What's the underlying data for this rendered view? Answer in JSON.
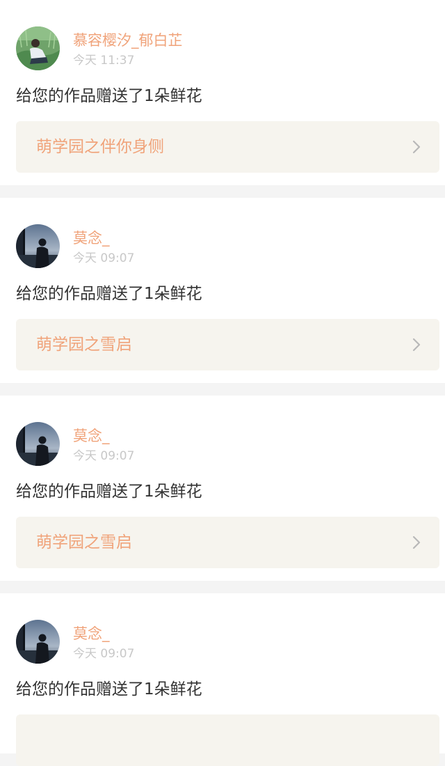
{
  "notifications": [
    {
      "username": "慕容樱汐_郁白芷",
      "time": "今天 11:37",
      "message": "给您的作品赠送了1朵鲜花",
      "work_title": "萌学园之伴你身侧",
      "avatar_icon": "girl-in-grass-avatar"
    },
    {
      "username": "莫念_",
      "time": "今天 09:07",
      "message": "给您的作品赠送了1朵鲜花",
      "work_title": "萌学园之雪启",
      "avatar_icon": "silhouette-window-avatar"
    },
    {
      "username": "莫念_",
      "time": "今天 09:07",
      "message": "给您的作品赠送了1朵鲜花",
      "work_title": "萌学园之雪启",
      "avatar_icon": "silhouette-window-avatar"
    },
    {
      "username": "莫念_",
      "time": "今天 09:07",
      "message": "给您的作品赠送了1朵鲜花",
      "work_title": "",
      "avatar_icon": "silhouette-window-avatar"
    }
  ],
  "colors": {
    "username": "#f0a37a",
    "work_title": "#f0a37a",
    "timestamp": "#c8c8c8",
    "message": "#333333",
    "work_link_bg": "#f6f4ee",
    "page_bg": "#f4f4f4",
    "tab_indicator": "#f26c8f"
  }
}
